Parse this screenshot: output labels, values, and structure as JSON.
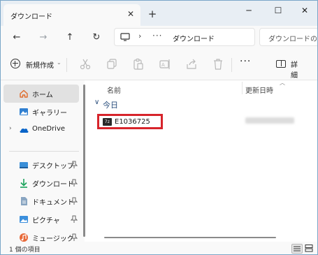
{
  "titlebar": {
    "tab_title": "ダウンロード",
    "tab_close": "✕",
    "new_tab": "+",
    "minimize": "─",
    "maximize": "☐",
    "close": "✕"
  },
  "address": {
    "back": "←",
    "forward": "→",
    "up": "↑",
    "refresh": "↻",
    "separator": "›",
    "more": "···",
    "location": "ダウンロード",
    "search_placeholder": "ダウンロードの検索"
  },
  "commandbar": {
    "new_label": "新規作成",
    "new_chevron": "⌄",
    "more": "···",
    "details_label": "詳細"
  },
  "sidebar": {
    "items": [
      {
        "label": "ホーム",
        "icon": "home-icon"
      },
      {
        "label": "ギャラリー",
        "icon": "gallery-icon"
      },
      {
        "label": "OneDrive",
        "icon": "onedrive-icon"
      },
      {
        "label": "デスクトップ",
        "icon": "desktop-icon"
      },
      {
        "label": "ダウンロード",
        "icon": "download-icon"
      },
      {
        "label": "ドキュメント",
        "icon": "documents-icon"
      },
      {
        "label": "ピクチャ",
        "icon": "pictures-icon"
      },
      {
        "label": "ミュージック",
        "icon": "music-icon"
      }
    ],
    "expand_chevron": "›",
    "pin": "📌"
  },
  "content": {
    "column_name": "名前",
    "column_date": "更新日時",
    "sort_indicator": "︿",
    "group_chevron": "∨",
    "group_label": "今日",
    "file": {
      "name": "E1036725",
      "icon_text": "7z"
    }
  },
  "status": {
    "text": "1 個の項目"
  },
  "colors": {
    "highlight_border": "#d7242b",
    "selected_nav": "#e1e1e1",
    "group_text": "#2b4f7d"
  }
}
